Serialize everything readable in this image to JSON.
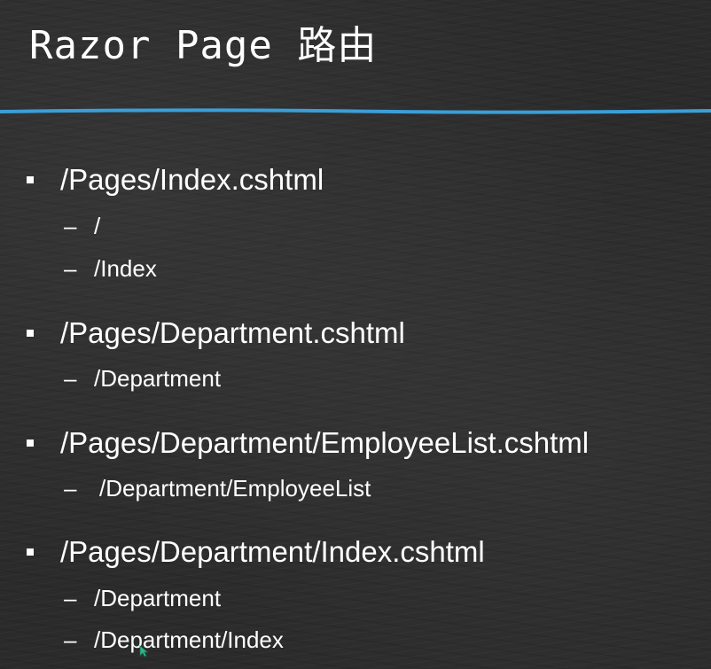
{
  "slide": {
    "title": "Razor Page 路由",
    "accent_color": "#3a9fd8",
    "text_color": "#ffffff",
    "items": [
      {
        "label": "/Pages/Index.cshtml",
        "routes": [
          "/",
          "/Index"
        ]
      },
      {
        "label": "/Pages/Department.cshtml",
        "routes": [
          "/Department"
        ]
      },
      {
        "label": "/Pages/Department/EmployeeList.cshtml",
        "routes": [
          "/Department/EmployeeList"
        ]
      },
      {
        "label": "/Pages/Department/Index.cshtml",
        "routes": [
          "/Department",
          "/Department/Index"
        ]
      }
    ],
    "sub_marker": "–"
  }
}
